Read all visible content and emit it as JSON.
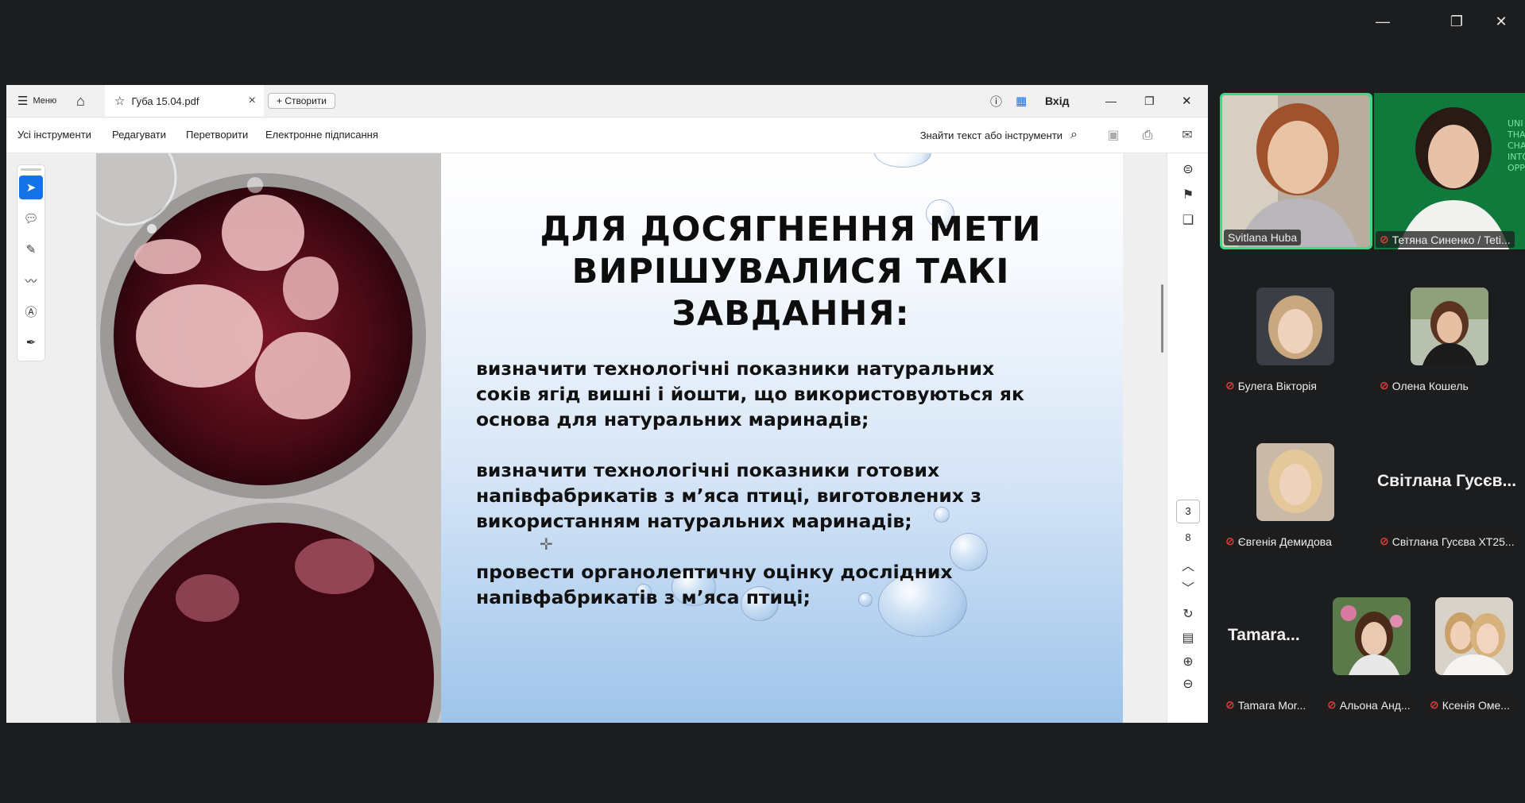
{
  "window": {
    "minimize": "—",
    "restore": "❐",
    "close": "✕"
  },
  "acrobat": {
    "menu_label": "Меню",
    "tab_title": "Губа 15.04.pdf",
    "tab_close": "×",
    "create_label": "Створити",
    "signin_label": "Вхід",
    "tools": [
      "Усі інструменти",
      "Редагувати",
      "Перетворити",
      "Електронне підписання"
    ],
    "search_label": "Знайти текст або інструменти",
    "current_page": "3",
    "total_pages": "8"
  },
  "slide": {
    "title_lines": [
      "ДЛЯ ДОСЯГНЕННЯ МЕТИ",
      "ВИРІШУВАЛИСЯ ТАКІ",
      "ЗАВДАННЯ:"
    ],
    "items": [
      "визначити технологічні показники натуральних соків ягід вишні і йошти, що використовуються як основа для натуральних маринадів;",
      "визначити технологічні показники готових напівфабрикатів з м’яса птиці, виготовлених з використанням натуральних маринадів;",
      "провести органолептичну оцінку дослідних напівфабрикатів з м’яса птиці;"
    ]
  },
  "participants": [
    {
      "name": "Svitlana Huba",
      "muted": false,
      "active": true
    },
    {
      "name": "Тетяна Синенко / Teti...",
      "muted": true
    },
    {
      "name": "Булега Вікторія",
      "muted": true
    },
    {
      "name": "Олена Кошель",
      "muted": true
    },
    {
      "name": "Євгенія Демидова",
      "muted": true
    },
    {
      "name": "Світлана Гусєва ХТ25...",
      "muted": true,
      "display": "Світлана Гусєв..."
    },
    {
      "name": "Tamara Mor...",
      "muted": true,
      "display": "Tamara..."
    },
    {
      "name": "Альона Анд...",
      "muted": true
    },
    {
      "name": "Ксенія Оме...",
      "muted": true
    }
  ],
  "colors": {
    "active_speaker_border": "#3ddc84",
    "acrobat_blue": "#1473e6",
    "muted_red": "#e4403b"
  }
}
